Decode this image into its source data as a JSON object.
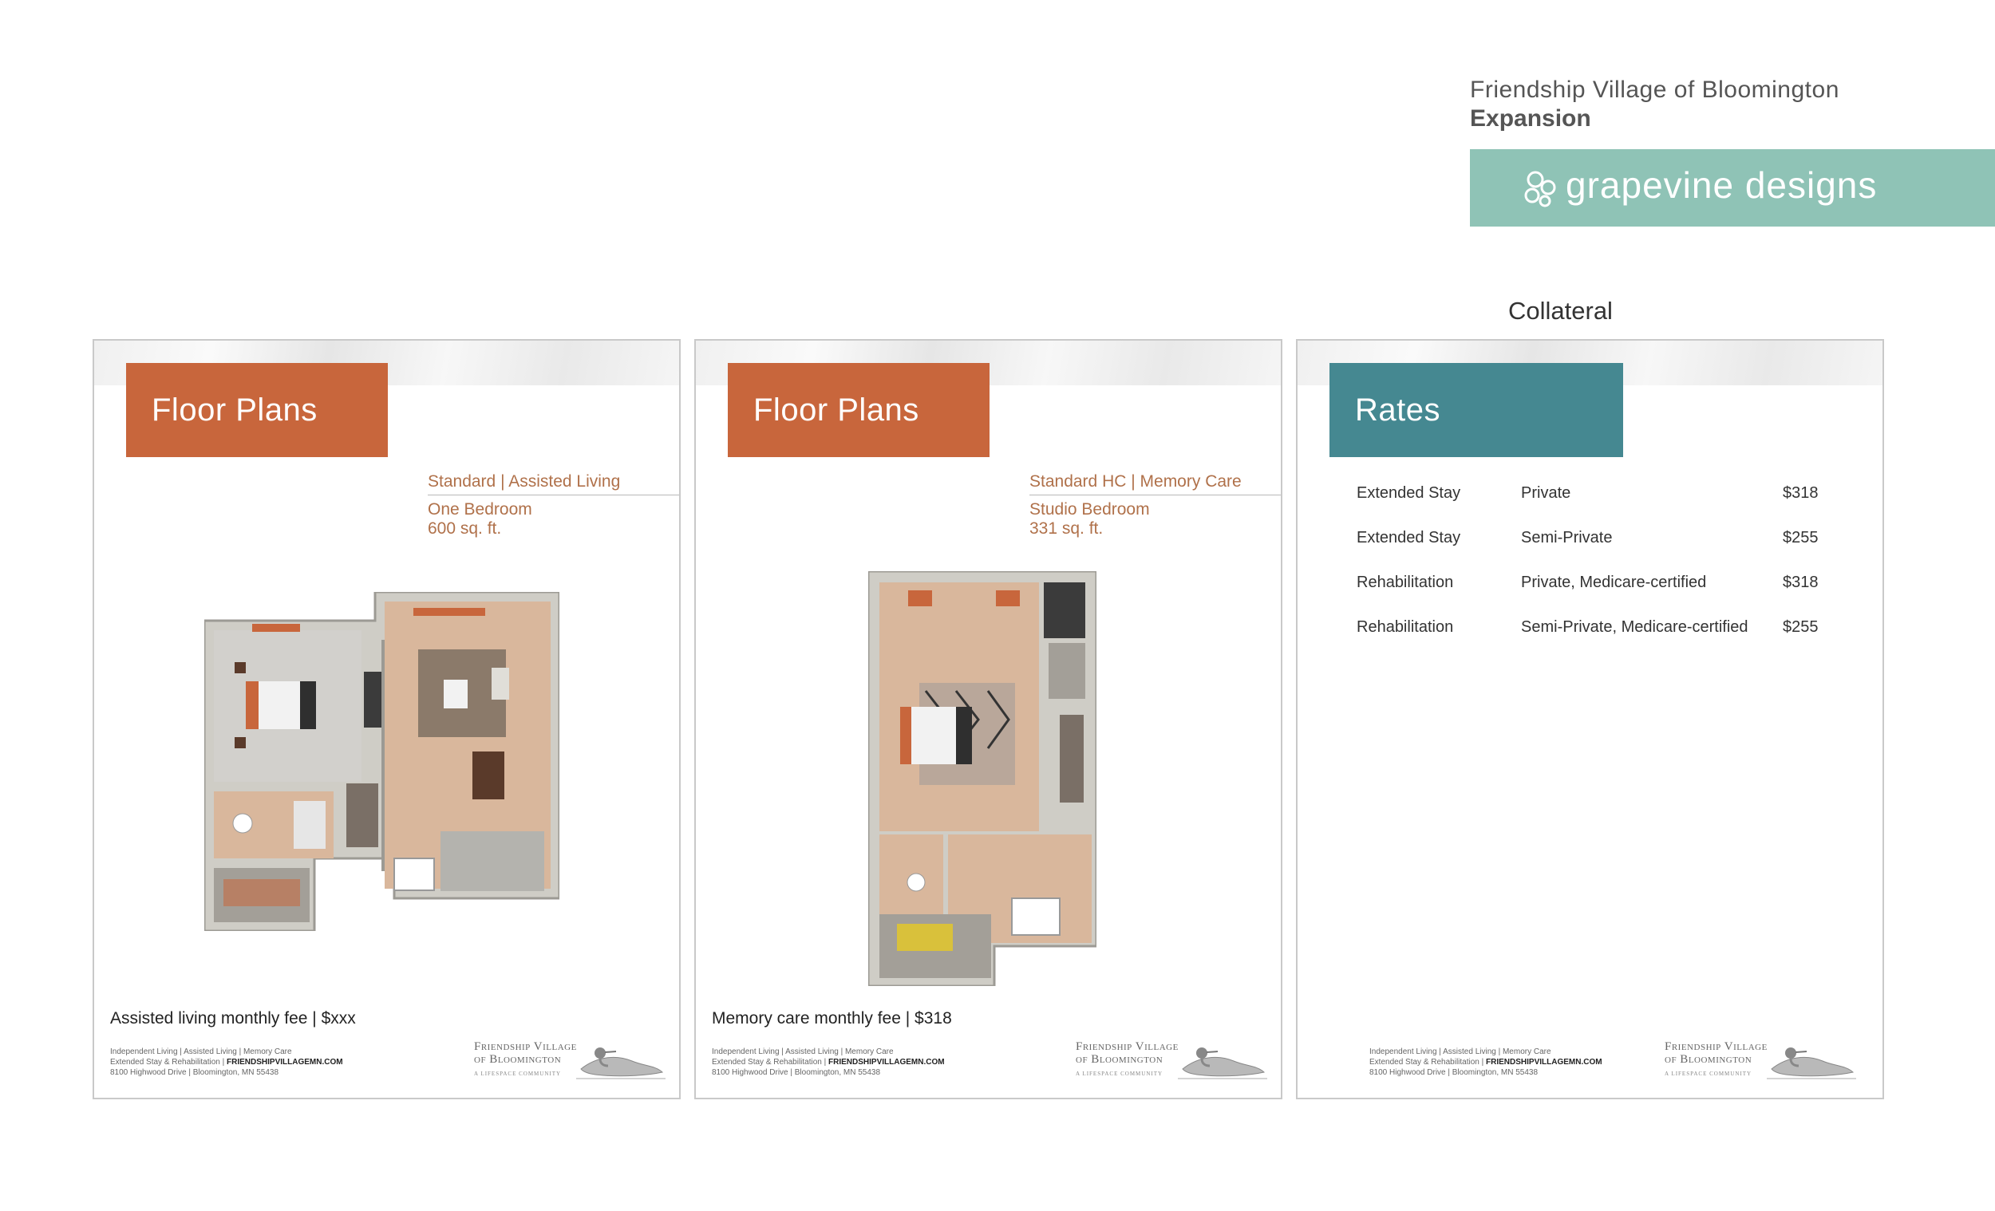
{
  "header": {
    "title": "Friendship Village of Bloomington",
    "subtitle": "Expansion",
    "brand_part1": "grapevine",
    "brand_part2": "designs",
    "section_label": "Collateral"
  },
  "colors": {
    "brand": "#8fc3b6",
    "floor_tag": "#c8663c",
    "rates_tag": "#458891",
    "accent_text": "#b0714a"
  },
  "cards": [
    {
      "tag": "Floor Plans",
      "sub_head": "Standard | Assisted Living",
      "line1": "One Bedroom",
      "line2": "600 sq. ft.",
      "fee": "Assisted living monthly fee | $xxx"
    },
    {
      "tag": "Floor Plans",
      "sub_head": "Standard HC | Memory Care",
      "line1": "Studio Bedroom",
      "line2": "331 sq. ft.",
      "fee": "Memory care monthly fee | $318"
    },
    {
      "tag": "Rates",
      "rates": [
        {
          "stay": "Extended Stay",
          "room": "Private",
          "price": "$318"
        },
        {
          "stay": "Extended Stay",
          "room": "Semi-Private",
          "price": "$255"
        },
        {
          "stay": "Rehabilitation",
          "room": "Private, Medicare-certified",
          "price": "$318"
        },
        {
          "stay": "Rehabilitation",
          "room": "Semi-Private, Medicare-certified",
          "price": "$255"
        }
      ]
    }
  ],
  "footer": {
    "line1": "Independent Living | Assisted Living | Memory Care",
    "line2_prefix": "Extended Stay & Rehabilitation | ",
    "website": "FRIENDSHIPVILLAGEMN.COM",
    "line3": "8100 Highwood Drive | Bloomington, MN 55438",
    "logo_line1": "Friendship Village",
    "logo_line2": "of Bloomington",
    "logo_tag": "A LIFESPACE COMMUNITY"
  }
}
